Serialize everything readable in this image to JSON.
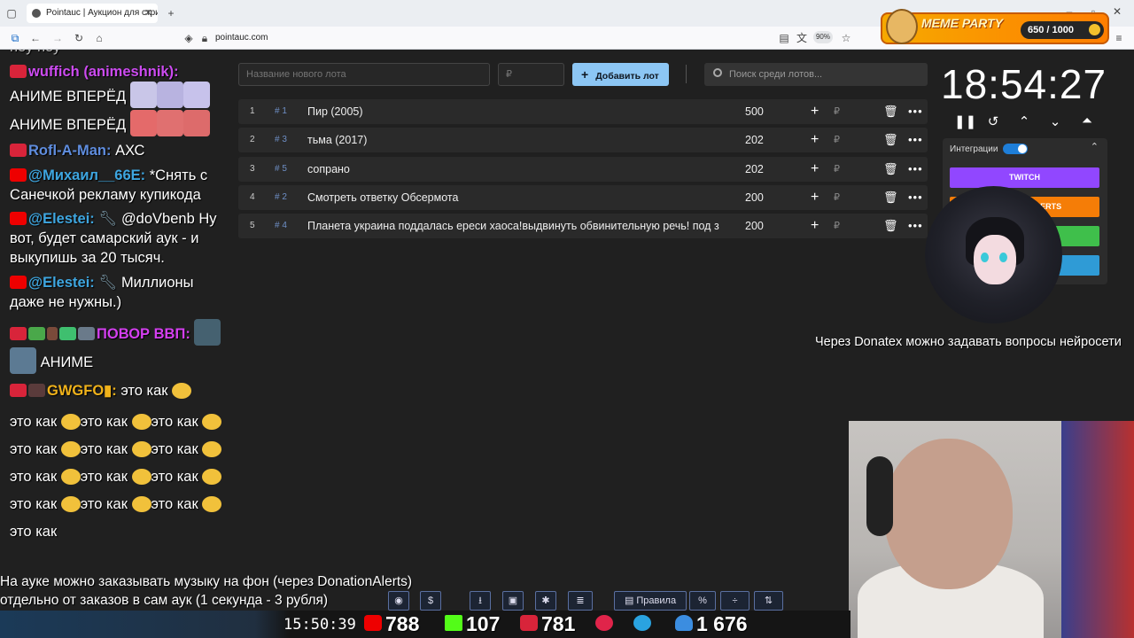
{
  "browser": {
    "tab_title": "Pointauc | Аукцион для стримеров",
    "url": "pointauc.com",
    "zoom": "90%"
  },
  "overlay": {
    "meme_title": "MEME PARTY",
    "meme_score": "650 / 1000"
  },
  "chat": {
    "top_cut": "ноу ноу",
    "m1_nick": "wuffich (animeshnik):",
    "m1_text1": "АНИМЕ ВПЕРЁД",
    "m1_text2": "АНИМЕ ВПЕРЁД",
    "m2_nick": "Rofl-A-Man:",
    "m2_text": "АХС",
    "m3_nick": "@Михаил__66E:",
    "m3_text": "*Снять с Санечкой рекламу купикода",
    "m4_nick": "@Elestei:",
    "m4_text": "@doVbenb Ну вот, будет самарский аук - и выкупишь за 20 тысяч.",
    "m5_nick": "@Elestei:",
    "m5_text": "Миллионы даже не нужны.)",
    "m6_nick": "ПОВОР ВВП:",
    "m6_text": "АНИМЕ",
    "m7_nick": "GWGFO",
    "m7_text": "это как"
  },
  "auction": {
    "lot_placeholder": "Название нового лота",
    "price_placeholder": "₽",
    "add_label": "Добавить лот",
    "search_placeholder": "Поиск среди лотов...",
    "lots": [
      {
        "n": "1",
        "tag": "# 1",
        "name": "Пир (2005)",
        "amount": "500"
      },
      {
        "n": "2",
        "tag": "# 3",
        "name": "тьма (2017)",
        "amount": "202"
      },
      {
        "n": "3",
        "tag": "# 5",
        "name": "сопрано",
        "amount": "202"
      },
      {
        "n": "4",
        "tag": "# 2",
        "name": "Смотреть ответку Обсермота",
        "amount": "200"
      },
      {
        "n": "5",
        "tag": "# 4",
        "name": "Планета украина поддалась ереси хаоса!выдвинуть обвинительную речь! под з",
        "amount": "200"
      }
    ]
  },
  "timer": {
    "time": "18:54:27"
  },
  "integrations": {
    "label": "Интеграции",
    "twitch": "TWITCH",
    "da": "DONATIONALERTS"
  },
  "overlay_text": {
    "donatex": "Через Donatex можно задавать вопросы нейросети",
    "music_line1": "На ауке можно заказывать музыку на фон (через DonationAlerts)",
    "music_line2": "отдельно от заказов в сам аук (1 секунда - 3 рубля)"
  },
  "toolbar": {
    "rules": "Правила"
  },
  "stats": {
    "clock": "15:50:39",
    "youtube": "788",
    "kick": "107",
    "live": "781",
    "telegram_label": "",
    "viewers": "1 676"
  },
  "colors": {
    "accent": "#8cc6f4",
    "twitch": "#9147ff",
    "da": "#f57d07"
  }
}
